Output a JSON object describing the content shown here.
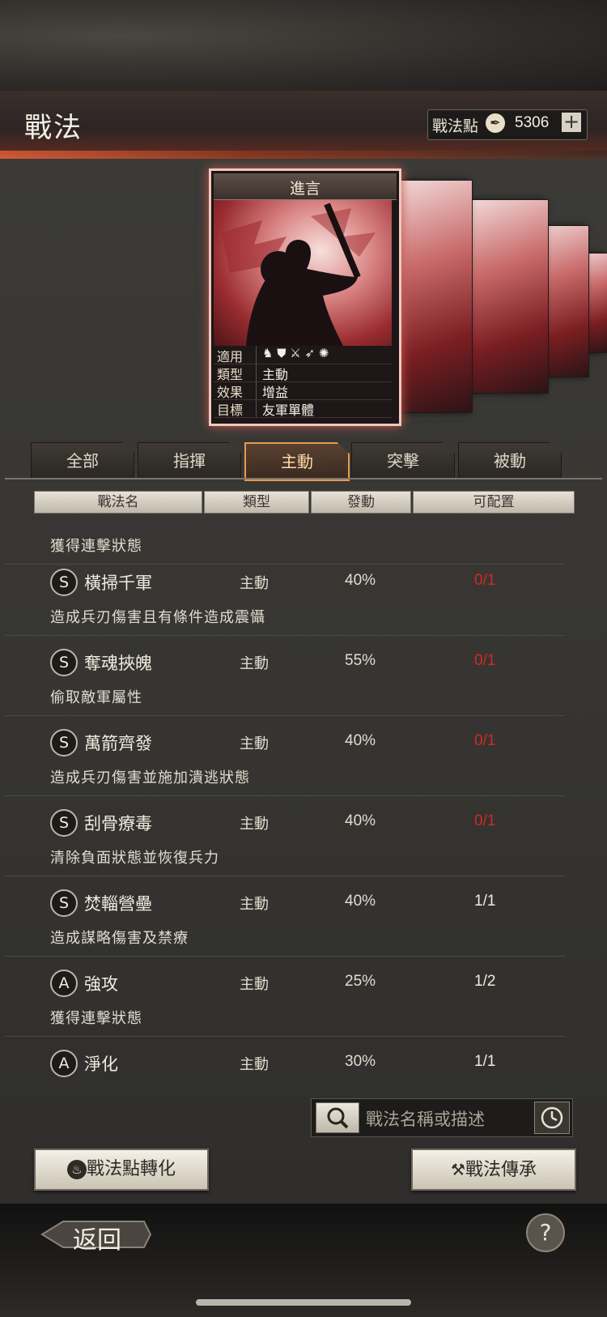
{
  "header": {
    "title": "戰法",
    "points_label": "戰法點",
    "points_value": "5306",
    "plus": "+"
  },
  "card": {
    "title": "進言",
    "info": [
      {
        "key": "適用",
        "value": ""
      },
      {
        "key": "類型",
        "value": "主動"
      },
      {
        "key": "效果",
        "value": "增益"
      },
      {
        "key": "目標",
        "value": "友軍單體"
      }
    ]
  },
  "tabs": [
    {
      "label": "全部",
      "active": false
    },
    {
      "label": "指揮",
      "active": false
    },
    {
      "label": "主動",
      "active": true
    },
    {
      "label": "突擊",
      "active": false
    },
    {
      "label": "被動",
      "active": false
    }
  ],
  "columns": [
    "戰法名",
    "類型",
    "發動",
    "可配置"
  ],
  "partial_top_desc": "獲得連擊狀態",
  "rows": [
    {
      "grade": "S",
      "name": "橫掃千軍",
      "type": "主動",
      "rate": "40%",
      "capacity": "0/1",
      "full": true,
      "desc": "造成兵刃傷害且有條件造成震懾"
    },
    {
      "grade": "S",
      "name": "奪魂挾魄",
      "type": "主動",
      "rate": "55%",
      "capacity": "0/1",
      "full": true,
      "desc": "偷取敵軍屬性"
    },
    {
      "grade": "S",
      "name": "萬箭齊發",
      "type": "主動",
      "rate": "40%",
      "capacity": "0/1",
      "full": true,
      "desc": "造成兵刃傷害並施加潰逃狀態"
    },
    {
      "grade": "S",
      "name": "刮骨療毒",
      "type": "主動",
      "rate": "40%",
      "capacity": "0/1",
      "full": true,
      "desc": "清除負面狀態並恢復兵力"
    },
    {
      "grade": "S",
      "name": "焚輜營壘",
      "type": "主動",
      "rate": "40%",
      "capacity": "1/1",
      "full": false,
      "desc": "造成謀略傷害及禁療"
    },
    {
      "grade": "A",
      "name": "強攻",
      "type": "主動",
      "rate": "25%",
      "capacity": "1/2",
      "full": false,
      "desc": "獲得連擊狀態"
    },
    {
      "grade": "A",
      "name": "淨化",
      "type": "主動",
      "rate": "30%",
      "capacity": "1/1",
      "full": false,
      "desc": ""
    }
  ],
  "search": {
    "placeholder": "戰法名稱或描述"
  },
  "buttons": {
    "convert": "戰法點轉化",
    "inherit": "戰法傳承"
  },
  "footer": {
    "back": "返回",
    "help": "?"
  },
  "colors": {
    "accent": "#e79a4e",
    "full_capacity": "#d12a22",
    "card_frame": "#f0c8c0"
  },
  "icons": [
    "fire-icon",
    "hammer-icon",
    "search-icon",
    "clock-icon",
    "help-icon",
    "quill-icon"
  ]
}
